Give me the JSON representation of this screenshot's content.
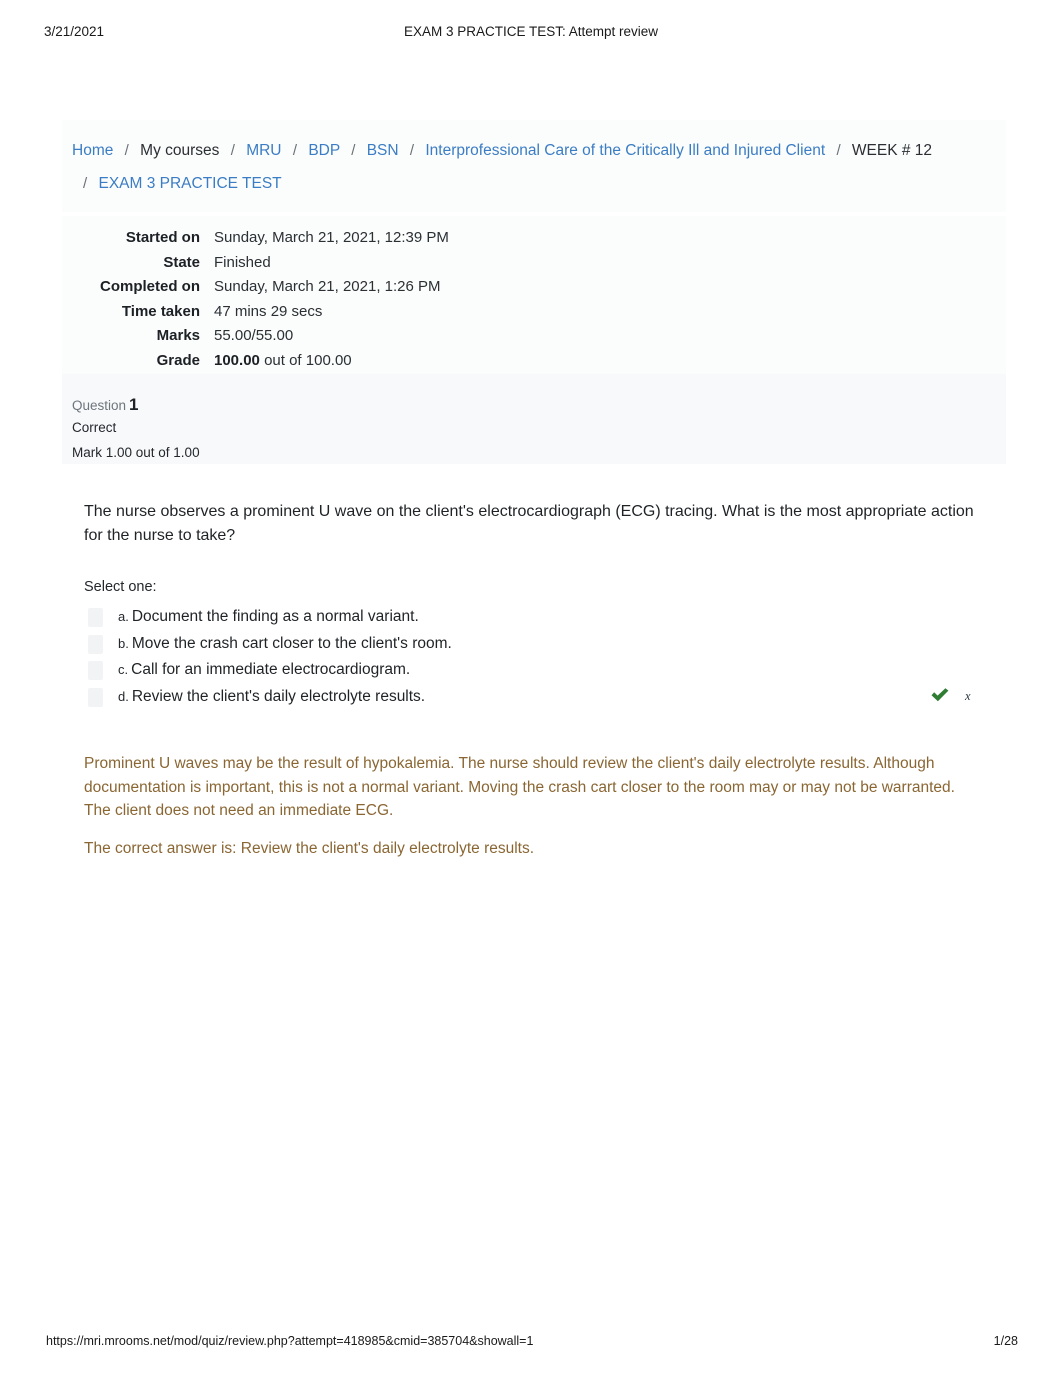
{
  "print_header": {
    "date": "3/21/2021",
    "title": "EXAM 3 PRACTICE TEST: Attempt review"
  },
  "breadcrumb": {
    "separator": "/",
    "row1": [
      {
        "label": "Home",
        "is_link": true
      },
      {
        "label": "My courses",
        "is_link": false
      },
      {
        "label": "MRU",
        "is_link": true
      },
      {
        "label": "BDP",
        "is_link": true
      },
      {
        "label": "BSN",
        "is_link": true
      },
      {
        "label": "Interprofessional Care of the Critically Ill and Injured Client",
        "is_link": true
      },
      {
        "label": "WEEK # 12",
        "is_link": false
      }
    ],
    "row2": [
      {
        "label": "EXAM 3 PRACTICE TEST",
        "is_link": true
      }
    ]
  },
  "summary": {
    "rows": [
      {
        "key": "Started on",
        "value": "Sunday, March 21, 2021, 12:39 PM"
      },
      {
        "key": "State",
        "value": "Finished"
      },
      {
        "key": "Completed on",
        "value": "Sunday, March 21, 2021, 1:26 PM"
      },
      {
        "key": "Time taken",
        "value": "47 mins 29 secs"
      },
      {
        "key": "Marks",
        "value": "55.00/55.00"
      }
    ],
    "grade_key": "Grade",
    "grade_value": "100.00",
    "grade_suffix": "out of 100.00"
  },
  "question": {
    "label": "Question",
    "number": "1",
    "state": "Correct",
    "mark": "Mark 1.00 out of 1.00",
    "text": "The nurse observes a prominent U wave on the client's electrocardiograph (ECG) tracing. What is the most appropriate action for the nurse to take?",
    "select_prompt": "Select one:",
    "options": [
      {
        "letter": "a.",
        "text": "Document the finding as a normal variant."
      },
      {
        "letter": "b.",
        "text": "Move the crash cart closer to the client's room."
      },
      {
        "letter": "c.",
        "text": "Call for an immediate electrocardiogram."
      },
      {
        "letter": "d.",
        "text": "Review the client's daily electrolyte results."
      }
    ],
    "correct_marker": "check-icon",
    "x_glyph": "x",
    "feedback": "Prominent U waves may be the result of hypokalemia. The nurse should review the client's daily electrolyte results. Although documentation is important, this is not a normal variant. Moving the crash cart closer to the room may or may not be warranted. The client does not need an immediate ECG.",
    "correct_answer_line": "The correct answer is: Review the client's daily electrolyte results."
  },
  "print_footer": {
    "url": "https://mri.mrooms.net/mod/quiz/review.php?attempt=418985&cmid=385704&showall=1",
    "page": "1/28"
  },
  "colors": {
    "link": "#3b7dc4",
    "feedback": "#8a6633",
    "correct_green": "#2f7d32",
    "panel_bg": "#fbfcfc",
    "qinfo_bg": "#f8f9fa"
  }
}
